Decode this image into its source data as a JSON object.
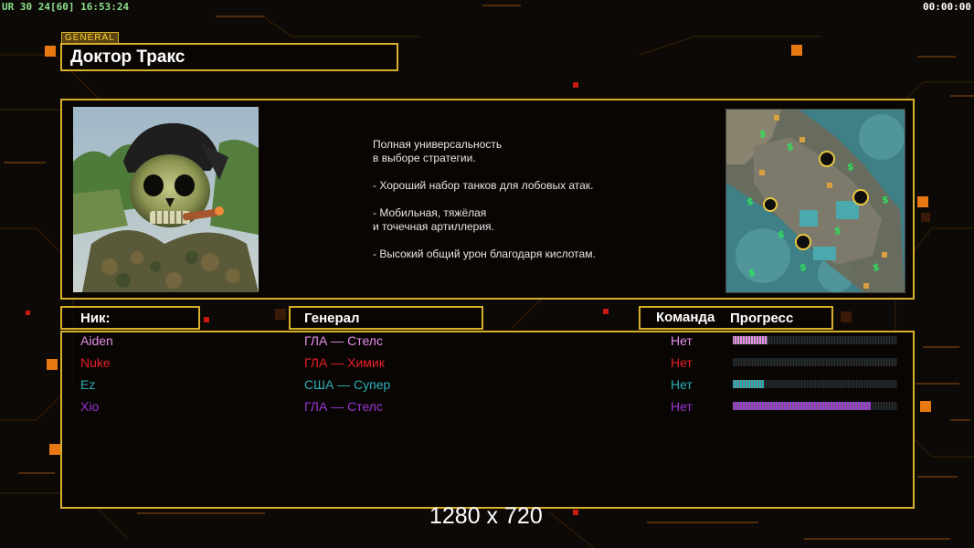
{
  "overlay": {
    "stats": "UR 30 24[60] 16:53:24",
    "clock": "00:00:00"
  },
  "header": {
    "tag": "GENERAL",
    "title": "Доктор Тракс"
  },
  "description": "Полная универсальность\nв выборе стратегии.\n\n- Хороший набор танков для лобовых атак.\n\n- Мобильная, тяжёлая\nи точечная артиллерия.\n\n- Высокий общий урон благодаря кислотам.",
  "columns": {
    "nick": "Ник:",
    "general": "Генерал",
    "team": "Команда",
    "progress": "Прогресс"
  },
  "players": [
    {
      "nick": "Aiden",
      "general": "ГЛА — Стелс",
      "team": "Нет",
      "color": "#e58fe8",
      "progress": 0.21
    },
    {
      "nick": "Nuke",
      "general": "ГЛА — Химик",
      "team": "Нет",
      "color": "#e8202a",
      "progress": 0.0
    },
    {
      "nick": "Ez",
      "general": "США — Супер",
      "team": "Нет",
      "color": "#2bb0b8",
      "progress": 0.19
    },
    {
      "nick": "Xio",
      "general": "ГЛА — Стелс",
      "team": "Нет",
      "color": "#9a35d4",
      "progress": 0.84
    }
  ],
  "resolution_label": "1280 x 720",
  "icons": {
    "portrait": "skull-general-portrait",
    "minimap": "map-preview"
  }
}
